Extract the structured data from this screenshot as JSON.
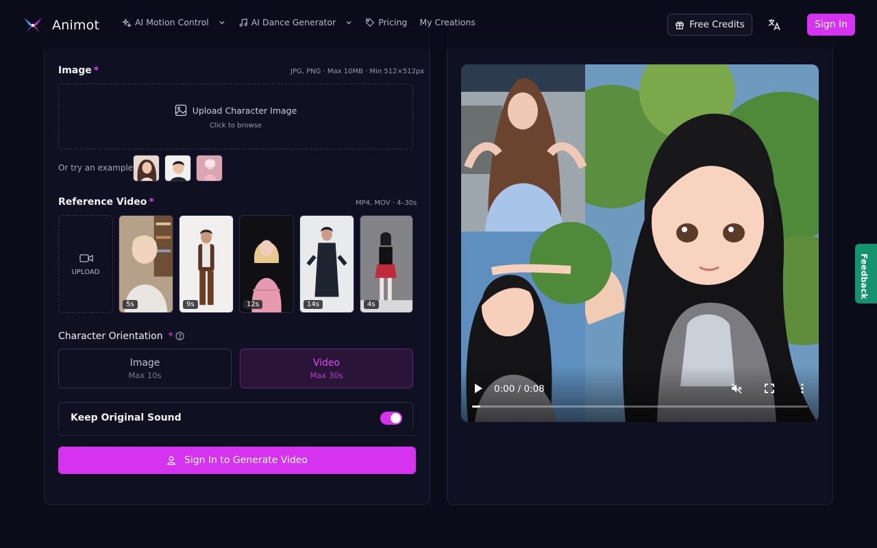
{
  "header": {
    "brand": "Animot",
    "nav": [
      {
        "label": "AI Motion Control",
        "icon": "sparkles-icon",
        "dropdown": true
      },
      {
        "label": "AI Dance Generator",
        "icon": "music-note-icon",
        "dropdown": true
      },
      {
        "label": "Pricing",
        "icon": "tag-icon",
        "dropdown": false
      },
      {
        "label": "My Creations",
        "icon": "",
        "dropdown": false
      }
    ],
    "free_credits": "Free Credits",
    "sign_in": "Sign In"
  },
  "form": {
    "image": {
      "label": "Image",
      "required": "*",
      "hint": "JPG, PNG · Max 10MB · Min 512×512px",
      "upload_title": "Upload Character Image",
      "upload_sub": "Click to browse",
      "examples_label": "Or try an example"
    },
    "reference_video": {
      "label": "Reference Video",
      "required": "*",
      "hint": "MP4, MOV · 4–30s",
      "upload_label": "UPLOAD",
      "clips": [
        "5s",
        "9s",
        "12s",
        "14s",
        "4s"
      ]
    },
    "orientation": {
      "label": "Character Orientation",
      "required": "*",
      "options": [
        {
          "title": "Image",
          "sub": "Max 10s"
        },
        {
          "title": "Video",
          "sub": "Max 30s",
          "selected": true
        }
      ]
    },
    "sound": {
      "label": "Keep Original Sound",
      "enabled": true
    },
    "generate": "Sign In to Generate Video"
  },
  "player": {
    "time": "0:00 / 0:08",
    "progress": 0.02,
    "muted": true
  },
  "feedback": "Feedback",
  "colors": {
    "accent": "#d633f0",
    "background": "#0b0c1a",
    "feedback": "#15936f"
  }
}
